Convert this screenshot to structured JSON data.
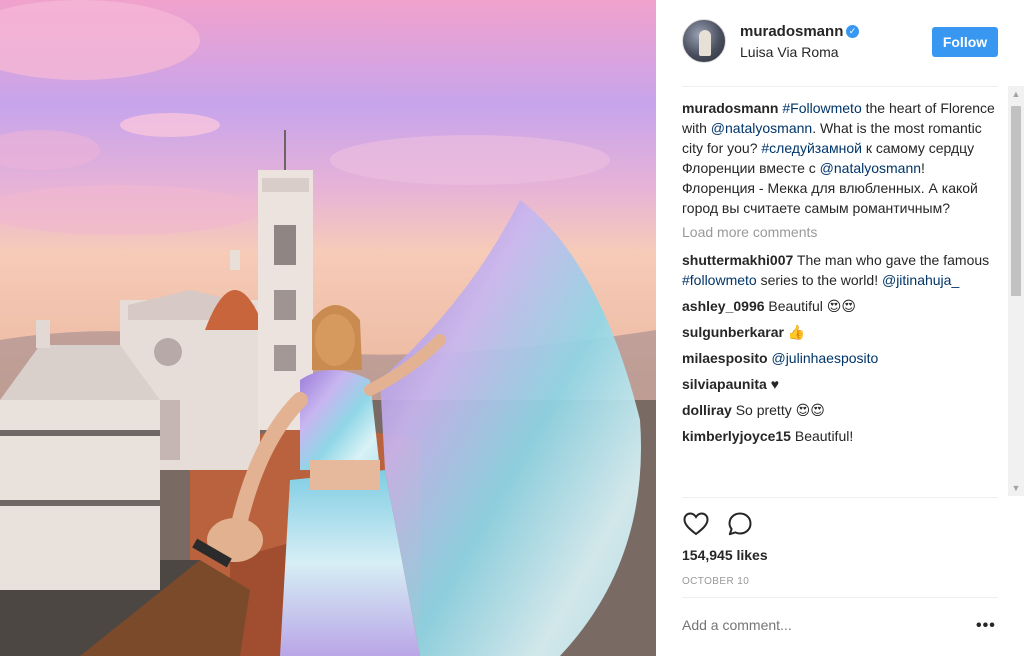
{
  "post": {
    "username": "muradosmann",
    "location": "Luisa Via Roma",
    "follow_label": "Follow",
    "verified_icon": "✓"
  },
  "caption": {
    "username": "muradosmann",
    "parts": [
      {
        "text": "#Followmeto",
        "type": "tag"
      },
      {
        "text": " the heart of Florence with ",
        "type": "text"
      },
      {
        "text": "@natalyosmann",
        "type": "tag"
      },
      {
        "text": ". What is the most romantic city for you? ",
        "type": "text"
      },
      {
        "text": "#следуйзамной",
        "type": "tag"
      },
      {
        "text": " к самому сердцу Флоренции вместе с ",
        "type": "text"
      },
      {
        "text": "@natalyosmann",
        "type": "tag"
      },
      {
        "text": "! Флоренция - Мекка для влюбленных. А какой город вы считаете самым романтичным?",
        "type": "text"
      }
    ]
  },
  "load_more_label": "Load more comments",
  "comments": [
    {
      "username": "shuttermakhi007",
      "text": "The man who gave the famous ",
      "tag1": "#followmeto",
      "text2": " series to the world! ",
      "tag2": "@jitinahuja_"
    },
    {
      "username": "ashley_0996",
      "text": "Beautiful 😍😍"
    },
    {
      "username": "sulgunberkarar",
      "text": "👍"
    },
    {
      "username": "milaesposito",
      "text": "",
      "tag1": "@julinhaesposito"
    },
    {
      "username": "silviapaunita",
      "text": "♥"
    },
    {
      "username": "dolliray",
      "text": "So pretty 😍😍"
    },
    {
      "username": "kimberlyjoyce15",
      "text": "Beautiful!"
    }
  ],
  "stats": {
    "likes": "154,945 likes",
    "date": "OCTOBER 10"
  },
  "add_comment": {
    "placeholder": "Add a comment...",
    "more_label": "•••"
  },
  "colors": {
    "accent": "#3897f0",
    "link": "#003569",
    "muted": "#999999"
  },
  "icons": {
    "like": "heart-icon",
    "comment": "comment-bubble-icon",
    "options": "more-options-icon"
  }
}
